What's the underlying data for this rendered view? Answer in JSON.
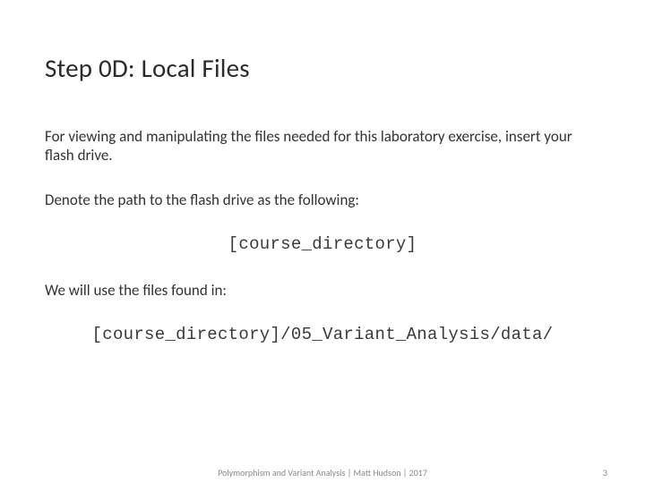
{
  "title": "Step 0D: Local Files",
  "p1": "For viewing and manipulating the files needed for this laboratory exercise, insert your flash drive.",
  "p2": "Denote the path to the flash drive as the following:",
  "code1": "[course_directory]",
  "p3": "We will use the files found in:",
  "code2": "[course_directory]/05_Variant_Analysis/data/",
  "footer_center": "Polymorphism and Variant Analysis | Matt Hudson | 2017",
  "footer_page": "3"
}
